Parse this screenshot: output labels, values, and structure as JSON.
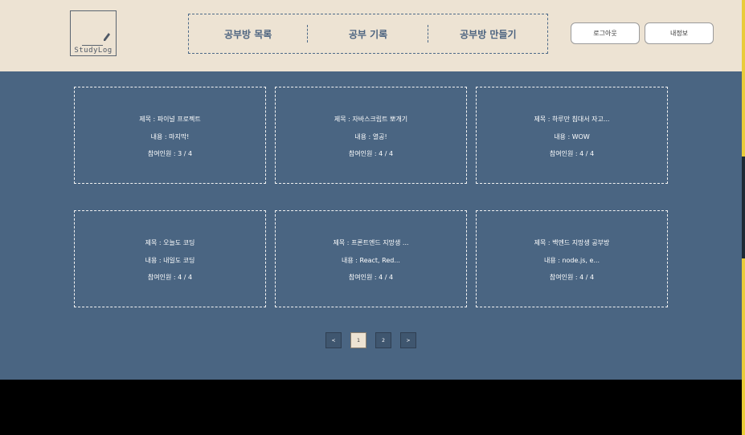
{
  "header": {
    "logo_text": "StudyLog",
    "nav": [
      "공부방 목록",
      "공부 기록",
      "공부방 만들기"
    ],
    "logout_label": "로그아웃",
    "myinfo_label": "내정보"
  },
  "rooms": [
    {
      "title": "제목 : 파이널 프로젝트",
      "content": "내용 : 마지막!",
      "members": "참여인원 : 3 / 4"
    },
    {
      "title": "제목 : 자바스크립트 뽀개기",
      "content": "내용 : 열공!",
      "members": "참여인원 : 4 / 4"
    },
    {
      "title": "제목 : 하루만 침대서 자고...",
      "content": "내용 : WOW",
      "members": "참여인원 : 4 / 4"
    },
    {
      "title": "제목 : 오늘도 코딩",
      "content": "내용 : 내일도 코딩",
      "members": "참여인원 : 4 / 4"
    },
    {
      "title": "제목 : 프론트엔드 지망생 ...",
      "content": "내용 : React, Red...",
      "members": "참여인원 : 4 / 4"
    },
    {
      "title": "제목 : 백엔드 지망생 공부방",
      "content": "내용 : node.js, e...",
      "members": "참여인원 : 4 / 4"
    }
  ],
  "pagination": {
    "prev": "<",
    "pages": [
      "1",
      "2"
    ],
    "current_page": "1",
    "next": ">"
  },
  "colors": {
    "header_bg": "#ede3d3",
    "body_bg": "#4a6582",
    "accent": "#4d6480"
  }
}
